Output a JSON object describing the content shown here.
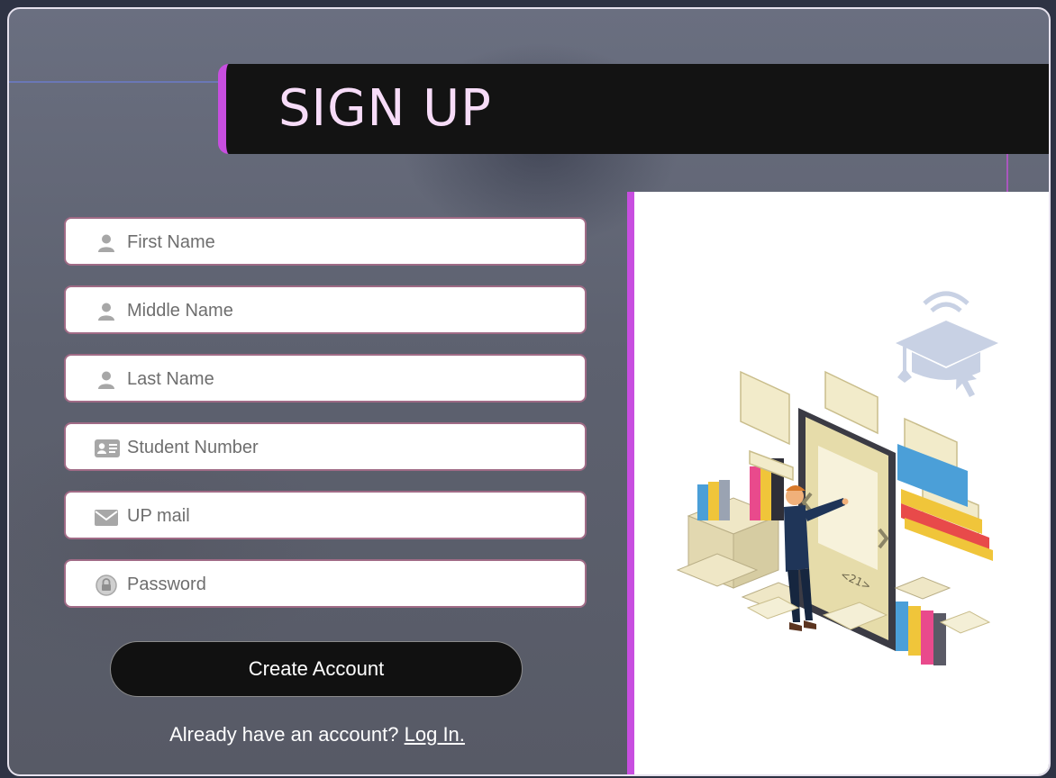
{
  "header": {
    "title": "SIGN UP"
  },
  "form": {
    "fields": [
      {
        "icon": "user-icon",
        "placeholder": "First Name",
        "type": "text"
      },
      {
        "icon": "user-icon",
        "placeholder": "Middle Name",
        "type": "text"
      },
      {
        "icon": "user-icon",
        "placeholder": "Last Name",
        "type": "text"
      },
      {
        "icon": "id-card-icon",
        "placeholder": "Student Number",
        "type": "text"
      },
      {
        "icon": "envelope-icon",
        "placeholder": "UP mail",
        "type": "email"
      },
      {
        "icon": "lock-icon",
        "placeholder": "Password",
        "type": "password"
      }
    ],
    "submit_label": "Create Account",
    "login_prompt": "Already have an account?",
    "login_link": "Log In."
  },
  "illustration": {
    "page_label": "<21>"
  },
  "colors": {
    "accent": "#c84ee0",
    "header_bg": "#131313",
    "title_text": "#f7dcf8",
    "button_bg": "#111111"
  }
}
